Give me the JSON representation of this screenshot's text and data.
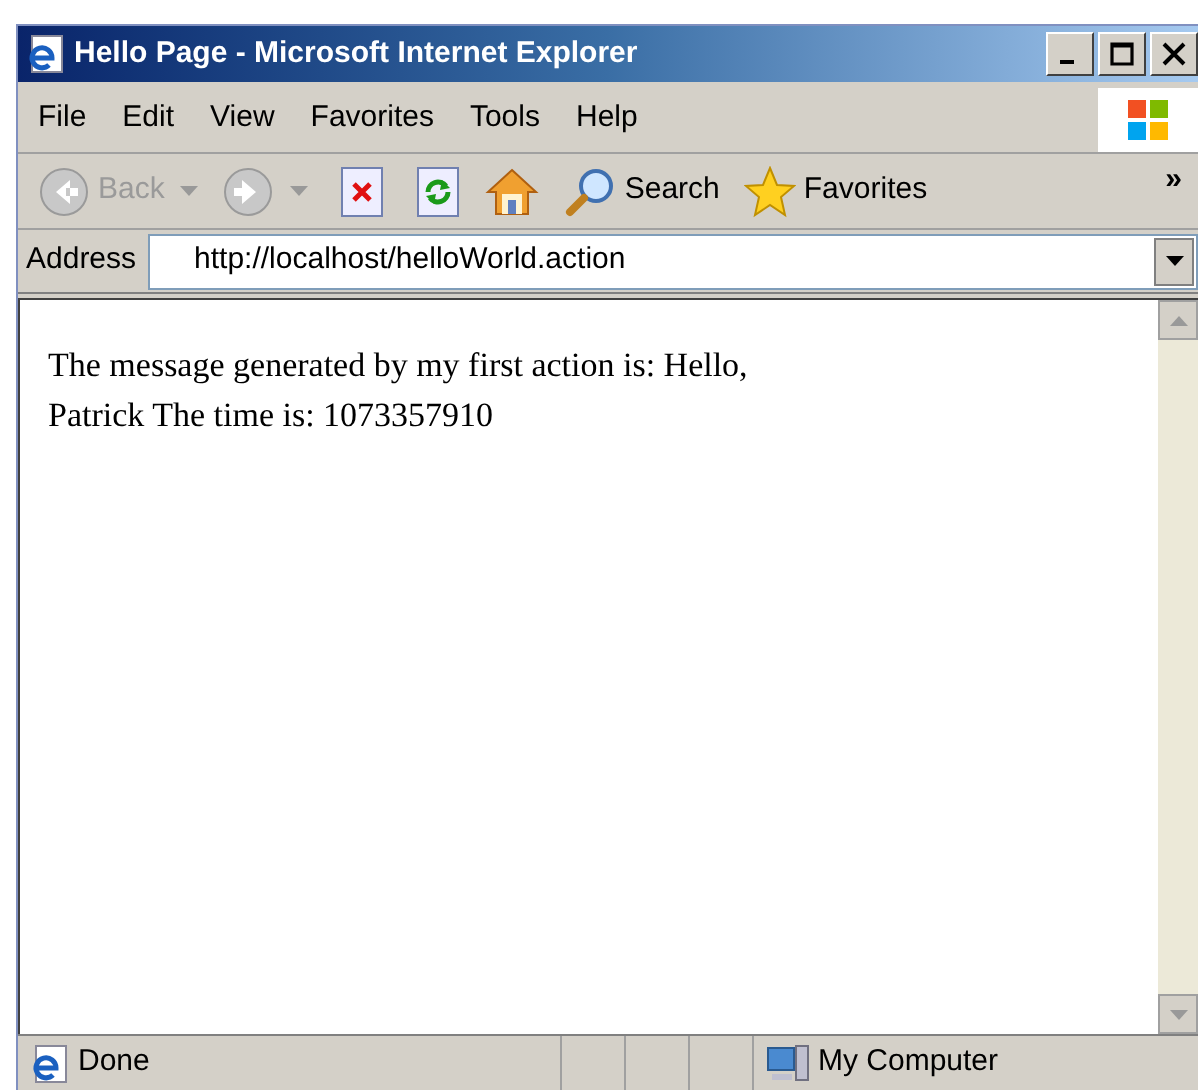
{
  "window": {
    "title": "Hello Page - Microsoft Internet Explorer"
  },
  "menu": [
    "File",
    "Edit",
    "View",
    "Favorites",
    "Tools",
    "Help"
  ],
  "toolbar": [
    {
      "kind": "back",
      "label": "Back",
      "disabled": true
    },
    {
      "kind": "forward",
      "disabled": true
    },
    {
      "kind": "stop"
    },
    {
      "kind": "refresh"
    },
    {
      "kind": "home"
    },
    {
      "kind": "search",
      "label": "Search"
    },
    {
      "kind": "favorites",
      "label": "Favorites"
    }
  ],
  "chevron": "»",
  "address": {
    "label": "Address",
    "value": "http://localhost/helloWorld.action"
  },
  "content": "The message generated by my first action is: Hello, Patrick The time is: 1073357910",
  "status_bar": {
    "text": "Done",
    "zone": "My Computer"
  }
}
